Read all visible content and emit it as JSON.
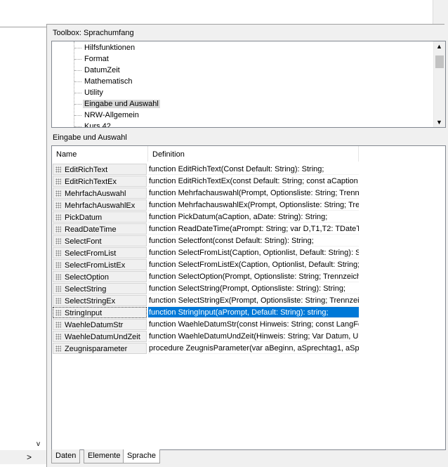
{
  "toolbox": {
    "title": "Toolbox: Sprachumfang",
    "items": [
      "Hilfsfunktionen",
      "Format",
      "DatumZeit",
      "Mathematisch",
      "Utility",
      "Eingabe und Auswahl",
      "NRW-Allgemein",
      "Kurs 42"
    ],
    "selected_index": 5
  },
  "section": {
    "title": "Eingabe und Auswahl"
  },
  "grid": {
    "columns": [
      "Name",
      "Definition"
    ],
    "rows": [
      {
        "name": "EditRichText",
        "definition": "function EditRichText(Const Default: String): String;"
      },
      {
        "name": "EditRichTextEx",
        "definition": "function EditRichTextEx(const Default: String; const aCaption"
      },
      {
        "name": "MehrfachAuswahl",
        "definition": "function Mehrfachauswahl(Prompt, Optionsliste: String; Trenn"
      },
      {
        "name": "MehrfachAuswahlEx",
        "definition": "function MehrfachauswahlEx(Prompt, Optionsliste: String; Tre"
      },
      {
        "name": "PickDatum",
        "definition": "function PickDatum(aCaption, aDate: String): String;"
      },
      {
        "name": "ReadDateTime",
        "definition": "function ReadDateTime(aPrompt: String; var D,T1,T2: TDateT"
      },
      {
        "name": "SelectFont",
        "definition": "function Selectfont(const Default: String): String;"
      },
      {
        "name": "SelectFromList",
        "definition": "function SelectFromList(Caption, Optionlist, Default: String): S"
      },
      {
        "name": "SelectFromListEx",
        "definition": "function SelectFromListEx(Caption, Optionlist, Default: String;"
      },
      {
        "name": "SelectOption",
        "definition": "function SelectOption(Prompt, Optionsliste: String; Trennzeich"
      },
      {
        "name": "SelectString",
        "definition": "function SelectString(Prompt, Optionsliste: String): String;"
      },
      {
        "name": "SelectStringEx",
        "definition": "function SelectStringEx(Prompt, Optionsliste: String; Trennzei"
      },
      {
        "name": "StringInput",
        "definition": "function StringInput(aPrompt, Default: String): string;"
      },
      {
        "name": "WaehleDatumStr",
        "definition": "function WaehleDatumStr(const Hinweis: String; const LangFo"
      },
      {
        "name": "WaehleDatumUndZeit",
        "definition": "function WaehleDatumUndZeit(Hinweis: String; Var Datum, Uh"
      },
      {
        "name": "Zeugnisparameter",
        "definition": "procedure ZeugnisParameter(var aBeginn, aSprechtag1, aSpr"
      }
    ],
    "selected_index": 12
  },
  "tabs": {
    "items": [
      "Daten",
      "Elemente",
      "Sprache"
    ],
    "active_index": 2
  },
  "left_panel": {
    "scroll_right_glyph": ">",
    "scroll_down_glyph": "v"
  },
  "colors": {
    "selection": "#0078d7",
    "tree_selection": "#d9d9d9",
    "background": "#f0f0f0"
  }
}
